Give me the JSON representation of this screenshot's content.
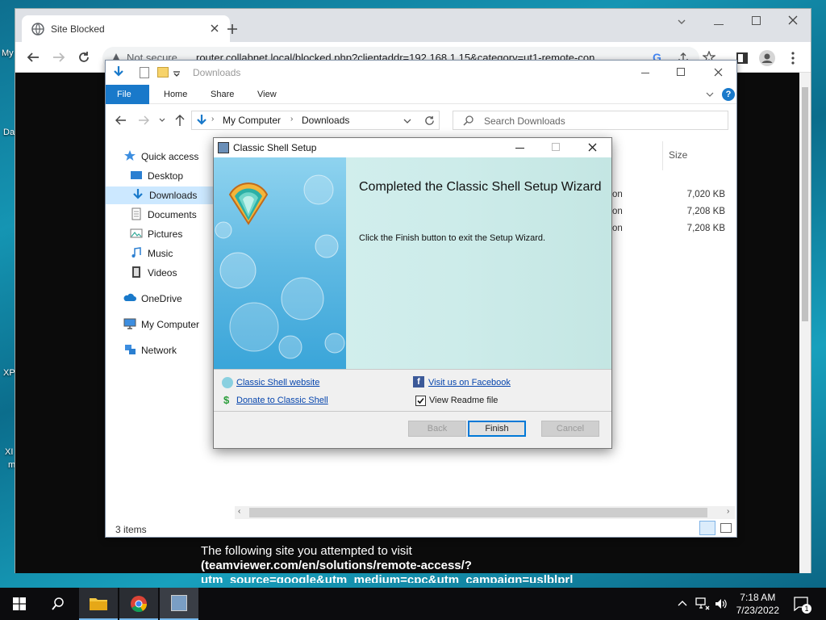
{
  "desktop": {
    "labels": [
      "My",
      "Da",
      "XP",
      "XI",
      "m"
    ]
  },
  "chrome": {
    "tab_title": "Site Blocked",
    "not_secure": "Not secure",
    "url": "router.collabnet.local/blocked.php?clientaddr=192.168.1.15&category=ut1-remote-con...",
    "blocked_line1": "The following site you attempted to visit",
    "blocked_line2": "(teamviewer.com/en/solutions/remote-access/?",
    "blocked_line3": "utm_source=google&utm_medium=cpc&utm_campaign=us|b|pr|"
  },
  "explorer": {
    "title": "Downloads",
    "ribbon_tabs": [
      "File",
      "Home",
      "Share",
      "View"
    ],
    "breadcrumb": [
      "My Computer",
      "Downloads"
    ],
    "search_placeholder": "Search Downloads",
    "column_size": "Size",
    "nav": [
      "Quick access",
      "Desktop",
      "Downloads",
      "Documents",
      "Pictures",
      "Music",
      "Videos",
      "OneDrive",
      "My Computer",
      "Network"
    ],
    "rows": [
      {
        "name_tail": "on",
        "size": "7,020 KB"
      },
      {
        "name_tail": "on",
        "size": "7,208 KB"
      },
      {
        "name_tail": "on",
        "size": "7,208 KB"
      }
    ],
    "status": "3 items"
  },
  "dialog": {
    "title": "Classic Shell Setup",
    "heading": "Completed the Classic Shell Setup Wizard",
    "subtext": "Click the Finish button to exit the Setup Wizard.",
    "link_website": "Classic Shell website",
    "link_donate": "Donate to Classic Shell",
    "link_facebook": "Visit us on Facebook",
    "readme_label": "View Readme file",
    "readme_checked": true,
    "back": "Back",
    "finish": "Finish",
    "cancel": "Cancel"
  },
  "taskbar": {
    "time": "7:18 AM",
    "date": "7/23/2022",
    "notifications": "1"
  },
  "colors": {
    "accent": "#1979ca",
    "link": "#0645ad",
    "selected": "#cce8ff"
  }
}
